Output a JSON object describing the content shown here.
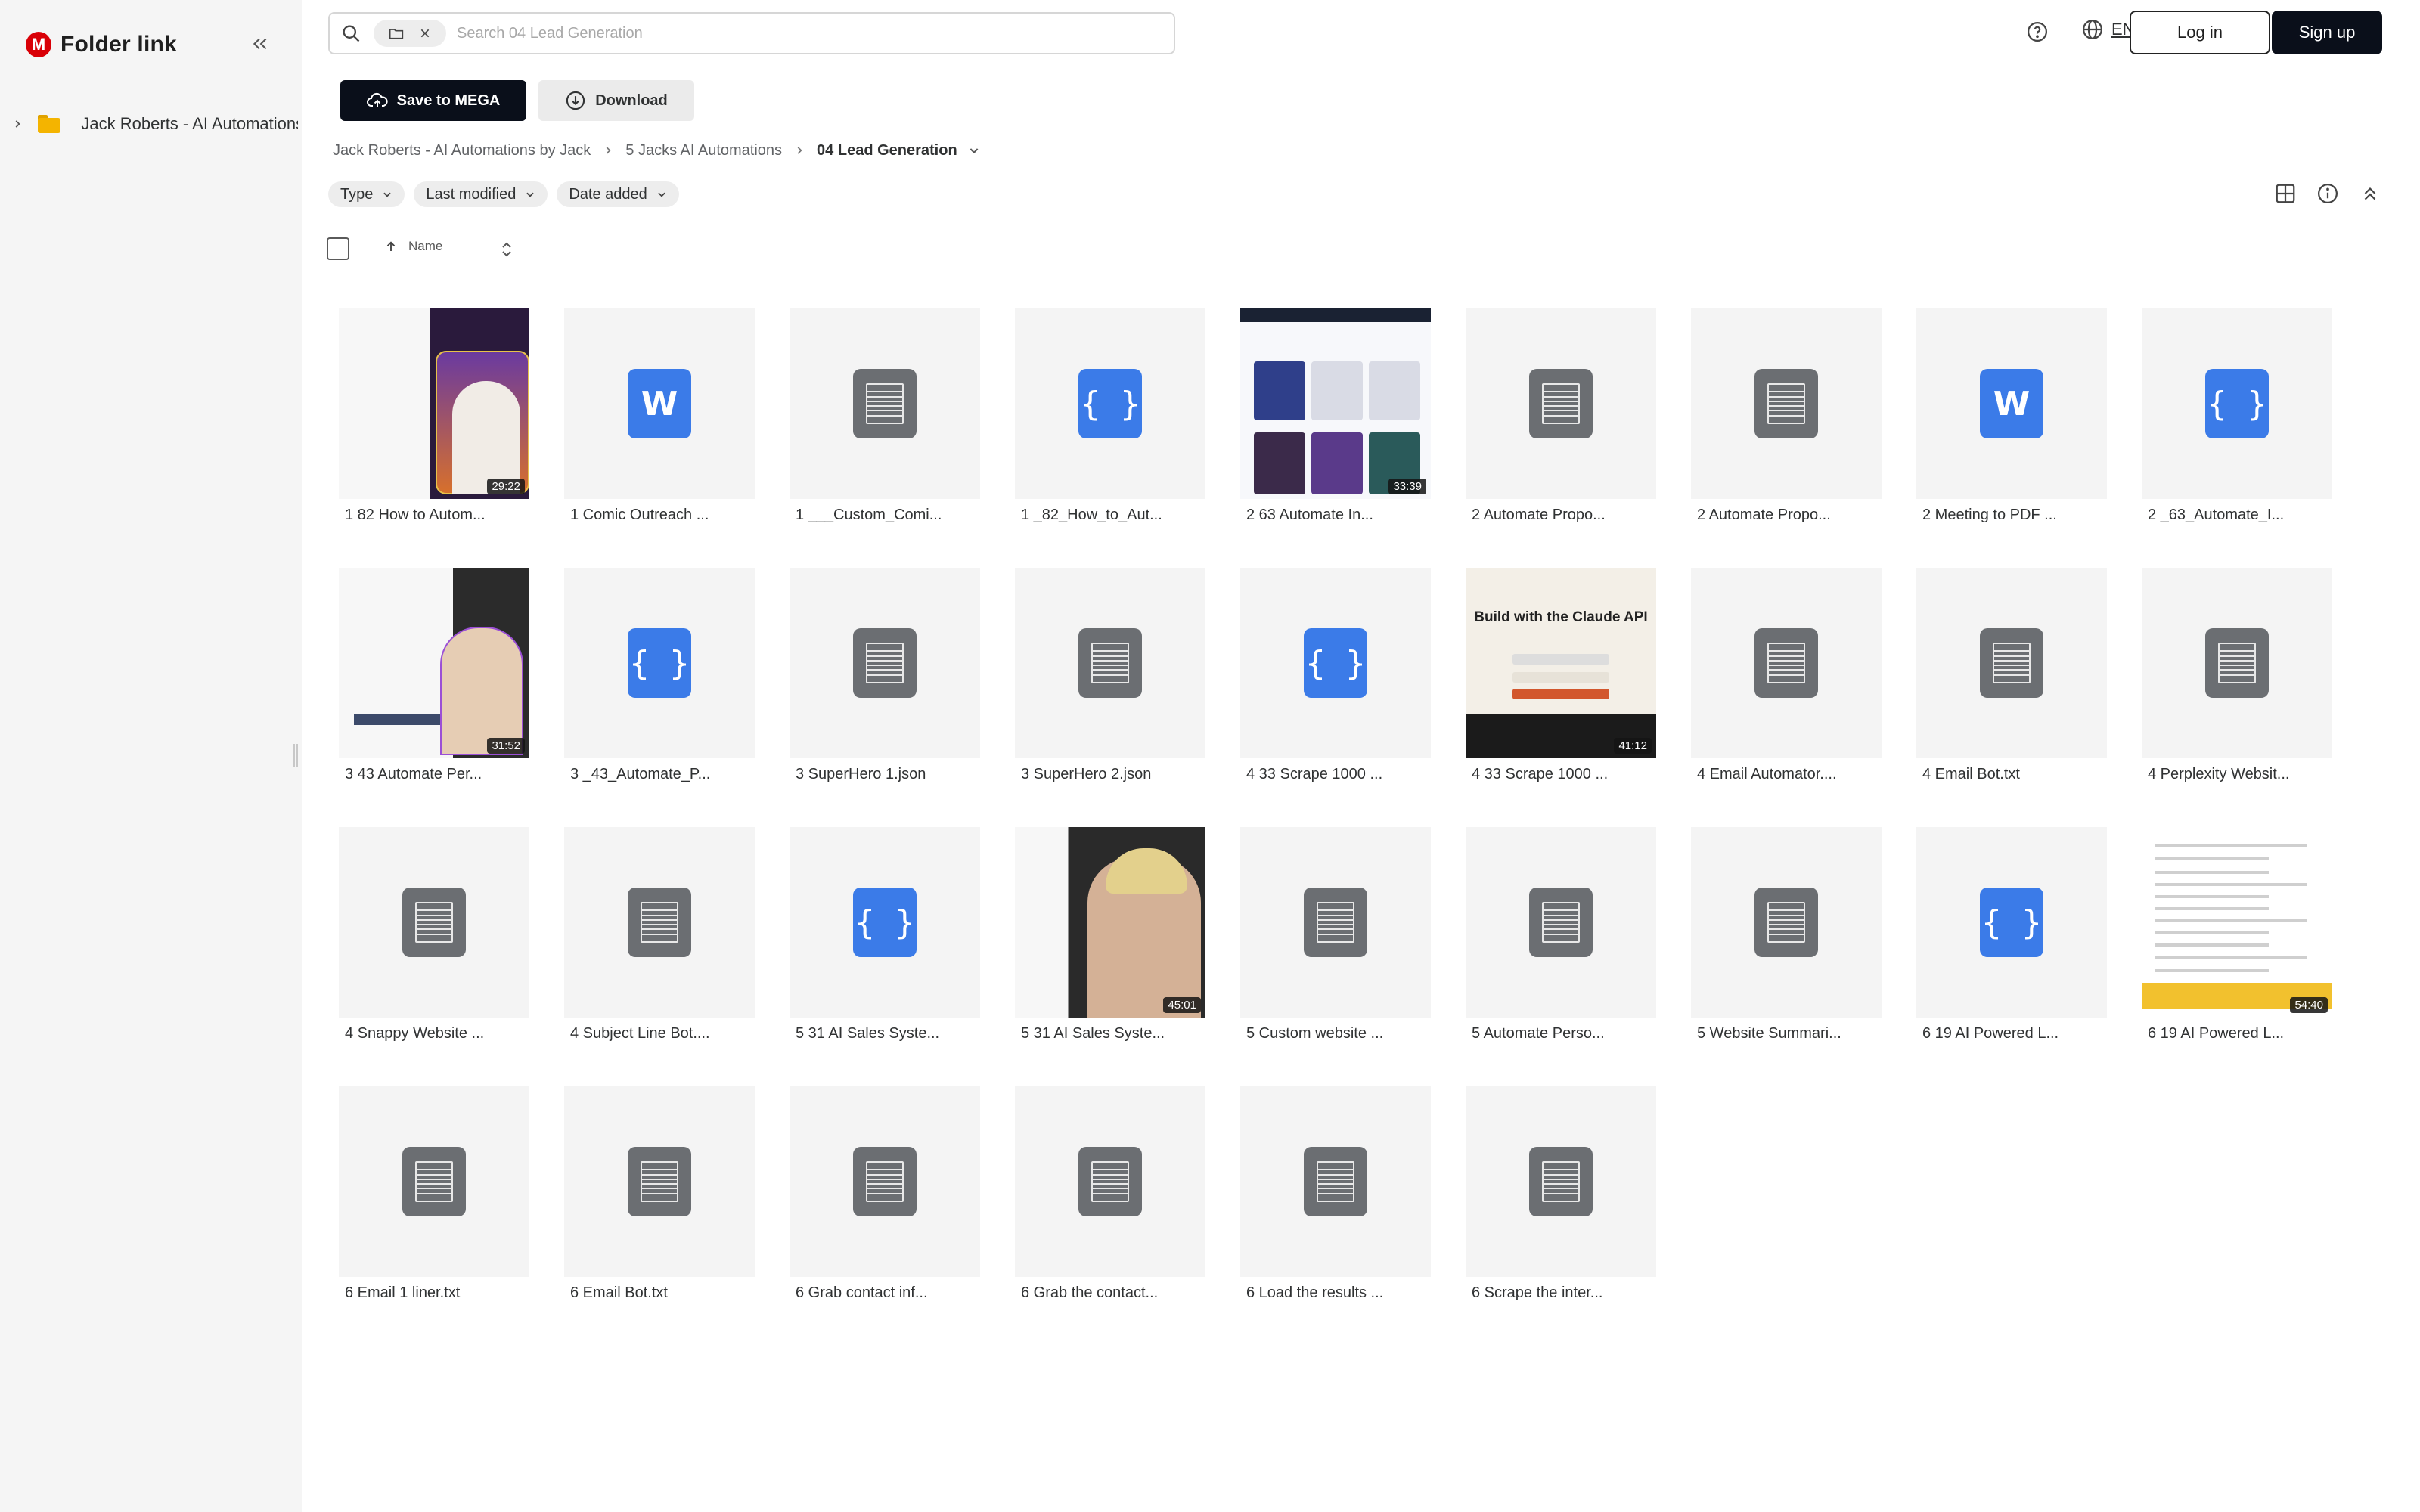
{
  "app": {
    "title": "Folder link",
    "logo_letter": "M"
  },
  "sidebar": {
    "tree_item": "Jack Roberts - AI Automations by Jack"
  },
  "search": {
    "placeholder": "Search 04 Lead Generation"
  },
  "header": {
    "lang": "EN",
    "login": "Log in",
    "signup": "Sign up"
  },
  "actions": {
    "save": "Save to MEGA",
    "download": "Download"
  },
  "breadcrumb": [
    "Jack Roberts - AI Automations by Jack",
    "5 Jacks AI Automations",
    "04 Lead Generation"
  ],
  "filters": [
    "Type",
    "Last modified",
    "Date added"
  ],
  "sort": {
    "label": "Name"
  },
  "colors": {
    "brand": "#d90007",
    "dark_button": "#0a0f1a",
    "file_blue": "#3b7be8",
    "file_gray": "#6b6e72"
  },
  "files": [
    {
      "name": "1 82 How to Autom...",
      "kind": "video",
      "art": "video1",
      "duration": "29:22"
    },
    {
      "name": "1 Comic Outreach ...",
      "kind": "doc"
    },
    {
      "name": "1 ___Custom_Comi...",
      "kind": "txt"
    },
    {
      "name": "1 _82_How_to_Aut...",
      "kind": "json"
    },
    {
      "name": "2  63 Automate In...",
      "kind": "video",
      "art": "web",
      "duration": "33:39"
    },
    {
      "name": "2 Automate Propo...",
      "kind": "txt"
    },
    {
      "name": "2 Automate Propo...",
      "kind": "txt"
    },
    {
      "name": "2 Meeting to PDF ...",
      "kind": "doc"
    },
    {
      "name": "2 _63_Automate_I...",
      "kind": "json"
    },
    {
      "name": "3 43 Automate Per...",
      "kind": "video",
      "art": "video2",
      "duration": "31:52"
    },
    {
      "name": "3 _43_Automate_P...",
      "kind": "json"
    },
    {
      "name": "3 SuperHero 1.json",
      "kind": "txt"
    },
    {
      "name": "3 SuperHero 2.json",
      "kind": "txt"
    },
    {
      "name": "4 33 Scrape 1000 ...",
      "kind": "json"
    },
    {
      "name": "4 33 Scrape 1000 ...",
      "kind": "video",
      "art": "claude",
      "duration": "41:12",
      "thumb_text": "Build with the Claude API"
    },
    {
      "name": "4 Email Automator....",
      "kind": "txt"
    },
    {
      "name": "4 Email Bot.txt",
      "kind": "txt"
    },
    {
      "name": "4 Perplexity Websit...",
      "kind": "txt"
    },
    {
      "name": "4 Snappy Website ...",
      "kind": "txt"
    },
    {
      "name": "4 Subject Line Bot....",
      "kind": "txt"
    },
    {
      "name": "5 31 AI Sales Syste...",
      "kind": "json"
    },
    {
      "name": "5 31 AI Sales Syste...",
      "kind": "video",
      "art": "video3",
      "duration": "45:01"
    },
    {
      "name": "5 Custom website ...",
      "kind": "txt"
    },
    {
      "name": "5 Automate Perso...",
      "kind": "txt"
    },
    {
      "name": "5 Website Summari...",
      "kind": "txt"
    },
    {
      "name": "6 19 AI Powered L...",
      "kind": "json"
    },
    {
      "name": "6 19 AI Powered L...",
      "kind": "video",
      "art": "doc",
      "duration": "54:40"
    },
    {
      "name": "6 Email 1 liner.txt",
      "kind": "txt"
    },
    {
      "name": "6 Email Bot.txt",
      "kind": "txt"
    },
    {
      "name": "6 Grab contact inf...",
      "kind": "txt"
    },
    {
      "name": "6 Grab the contact...",
      "kind": "txt"
    },
    {
      "name": "6 Load the results ...",
      "kind": "txt"
    },
    {
      "name": "6 Scrape the inter...",
      "kind": "txt"
    }
  ]
}
